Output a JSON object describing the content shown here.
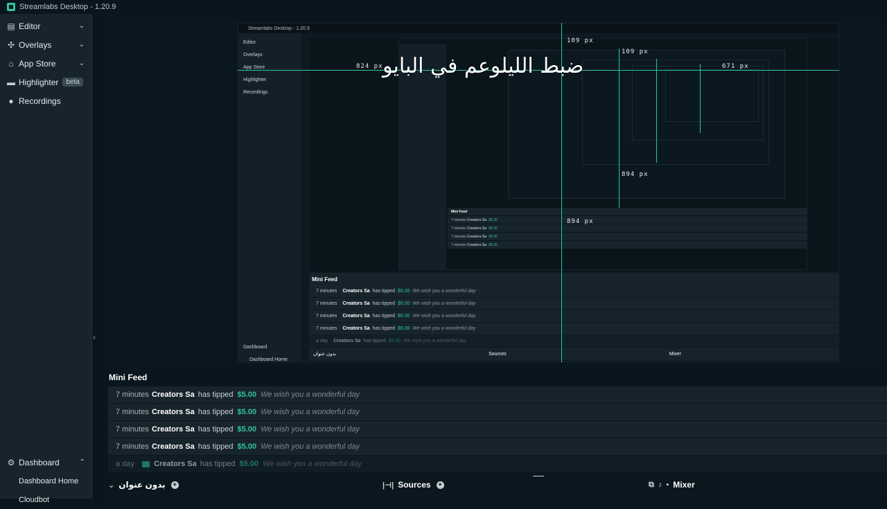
{
  "window": {
    "title": "Streamlabs Desktop - 1.20.9"
  },
  "sidebar": {
    "items": [
      {
        "label": "Editor",
        "icon": "editor-icon"
      },
      {
        "label": "Overlays",
        "icon": "overlays-icon"
      },
      {
        "label": "App Store",
        "icon": "store-icon"
      },
      {
        "label": "Highlighter",
        "icon": "highlighter-icon",
        "badge": "beta"
      },
      {
        "label": "Recordings",
        "icon": "recordings-icon"
      }
    ],
    "bottom": {
      "label": "Dashboard",
      "sub": [
        "Dashboard Home",
        "Cloudbot"
      ]
    }
  },
  "overlay": {
    "text": "ضبط الليلوعم في البايو",
    "measurements": [
      "109 px",
      "109 px",
      "824 px",
      "671 px",
      "894 px",
      "894 px"
    ]
  },
  "nested": {
    "feed_title": "Mini Feed",
    "scene_title": "بدون عنوان",
    "sources": "Sources",
    "mixer": "Mixer",
    "dashboard": "Dashboard",
    "dashboard_home": "Dashboard Home"
  },
  "minifeed": {
    "title": "Mini Feed",
    "rows": [
      {
        "time": "7 minutes",
        "name": "Creators Sa",
        "action": "has tipped",
        "amount": "$5.00",
        "message": "We wish you a wonderful day"
      },
      {
        "time": "7 minutes",
        "name": "Creators Sa",
        "action": "has tipped",
        "amount": "$5.00",
        "message": "We wish you a wonderful day"
      },
      {
        "time": "7 minutes",
        "name": "Creators Sa",
        "action": "has tipped",
        "amount": "$5.00",
        "message": "We wish you a wonderful day"
      },
      {
        "time": "7 minutes",
        "name": "Creators Sa",
        "action": "has tipped",
        "amount": "$5.00",
        "message": "We wish you a wonderful day"
      },
      {
        "time": "a day",
        "name": "Creators Sa",
        "action": "has tipped",
        "amount": "$5.00",
        "message": "We wish you a wonderful day"
      }
    ]
  },
  "footer": {
    "scene": "بدون عنوان",
    "sources": "Sources",
    "mixer": "Mixer"
  },
  "colors": {
    "accent": "#31c3a2",
    "bg": "#09161d",
    "sidebar": "#17242d"
  }
}
